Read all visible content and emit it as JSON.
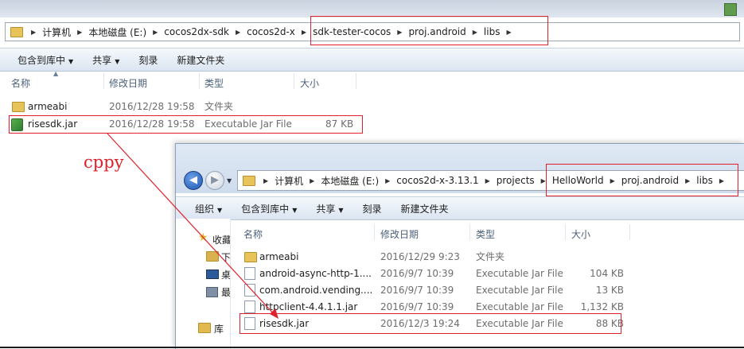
{
  "back_window": {
    "address": [
      "计算机",
      "本地磁盘 (E:)",
      "cocos2dx-sdk",
      "cocos2d-x",
      "sdk-tester-cocos",
      "proj.android",
      "libs"
    ],
    "toolbar": [
      "包含到库中",
      "共享",
      "刻录",
      "新建文件夹"
    ],
    "columns": {
      "name": "名称",
      "date": "修改日期",
      "type": "类型",
      "size": "大小"
    },
    "files": [
      {
        "name": "armeabi",
        "date": "2016/12/28 19:58",
        "type": "文件夹",
        "size": "",
        "icon": "folder-icon"
      },
      {
        "name": "risesdk.jar",
        "date": "2016/12/28 19:58",
        "type": "Executable Jar File",
        "size": "87 KB",
        "icon": "jar-icon"
      }
    ]
  },
  "annotation": {
    "text": "cppy",
    "color": "#e0202a"
  },
  "front_window": {
    "address": [
      "计算机",
      "本地磁盘 (E:)",
      "cocos2d-x-3.13.1",
      "projects",
      "HelloWorld",
      "proj.android",
      "libs"
    ],
    "toolbar": [
      "组织",
      "包含到库中",
      "共享",
      "刻录",
      "新建文件夹"
    ],
    "columns": {
      "name": "名称",
      "date": "修改日期",
      "type": "类型",
      "size": "大小"
    },
    "sidebar": [
      {
        "label": "收藏",
        "icon": "star-icon"
      },
      {
        "label": "下",
        "icon": "download-icon"
      },
      {
        "label": "桌",
        "icon": "desktop-icon"
      },
      {
        "label": "最",
        "icon": "recent-icon"
      },
      {
        "label": "库",
        "icon": "library-icon"
      }
    ],
    "files": [
      {
        "name": "armeabi",
        "date": "2016/12/29 9:23",
        "type": "文件夹",
        "size": "",
        "icon": "folder-icon"
      },
      {
        "name": "android-async-http-1....",
        "date": "2016/9/7 10:39",
        "type": "Executable Jar File",
        "size": "104 KB",
        "icon": "file-icon"
      },
      {
        "name": "com.android.vending....",
        "date": "2016/9/7 10:39",
        "type": "Executable Jar File",
        "size": "13 KB",
        "icon": "file-icon"
      },
      {
        "name": "httpclient-4.4.1.1.jar",
        "date": "2016/9/7 10:39",
        "type": "Executable Jar File",
        "size": "1,132 KB",
        "icon": "file-icon"
      },
      {
        "name": "risesdk.jar",
        "date": "2016/12/3 19:24",
        "type": "Executable Jar File",
        "size": "88 KB",
        "icon": "file-icon"
      }
    ]
  },
  "colors": {
    "highlight": "#e0202a",
    "toolbar": "#dbe5f1"
  }
}
